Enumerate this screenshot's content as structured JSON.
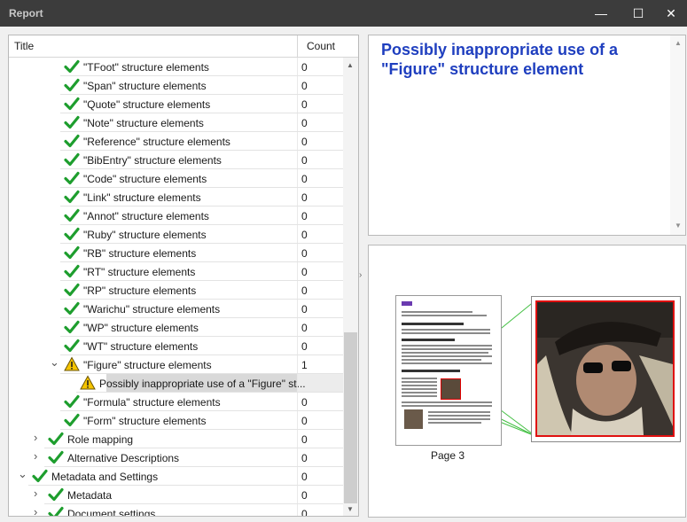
{
  "window": {
    "title": "Report",
    "min_icon": "minimize-icon",
    "max_icon": "maximize-icon",
    "close_icon": "close-icon"
  },
  "tree": {
    "columns": {
      "title": "Title",
      "count": "Count"
    },
    "rows": [
      {
        "label": "\"TFoot\" structure elements",
        "count": "0",
        "icon": "check-icon",
        "level": 4,
        "expander": ""
      },
      {
        "label": "\"Span\" structure elements",
        "count": "0",
        "icon": "check-icon",
        "level": 4,
        "expander": ""
      },
      {
        "label": "\"Quote\" structure elements",
        "count": "0",
        "icon": "check-icon",
        "level": 4,
        "expander": ""
      },
      {
        "label": "\"Note\" structure elements",
        "count": "0",
        "icon": "check-icon",
        "level": 4,
        "expander": ""
      },
      {
        "label": "\"Reference\" structure elements",
        "count": "0",
        "icon": "check-icon",
        "level": 4,
        "expander": ""
      },
      {
        "label": "\"BibEntry\" structure elements",
        "count": "0",
        "icon": "check-icon",
        "level": 4,
        "expander": ""
      },
      {
        "label": "\"Code\" structure elements",
        "count": "0",
        "icon": "check-icon",
        "level": 4,
        "expander": ""
      },
      {
        "label": "\"Link\" structure elements",
        "count": "0",
        "icon": "check-icon",
        "level": 4,
        "expander": ""
      },
      {
        "label": "\"Annot\" structure elements",
        "count": "0",
        "icon": "check-icon",
        "level": 4,
        "expander": ""
      },
      {
        "label": "\"Ruby\" structure elements",
        "count": "0",
        "icon": "check-icon",
        "level": 4,
        "expander": ""
      },
      {
        "label": "\"RB\" structure elements",
        "count": "0",
        "icon": "check-icon",
        "level": 4,
        "expander": ""
      },
      {
        "label": "\"RT\" structure elements",
        "count": "0",
        "icon": "check-icon",
        "level": 4,
        "expander": ""
      },
      {
        "label": "\"RP\" structure elements",
        "count": "0",
        "icon": "check-icon",
        "level": 4,
        "expander": ""
      },
      {
        "label": "\"Warichu\" structure elements",
        "count": "0",
        "icon": "check-icon",
        "level": 4,
        "expander": ""
      },
      {
        "label": "\"WP\" structure elements",
        "count": "0",
        "icon": "check-icon",
        "level": 4,
        "expander": ""
      },
      {
        "label": "\"WT\" structure elements",
        "count": "0",
        "icon": "check-icon",
        "level": 4,
        "expander": ""
      },
      {
        "label": "\"Figure\" structure elements",
        "count": "1",
        "icon": "warning-icon",
        "level": 4,
        "expander": "chevron-down-icon"
      },
      {
        "label": "Possibly inappropriate use of a \"Figure\" st...",
        "count": "",
        "icon": "warning-icon",
        "level": 5,
        "expander": "",
        "selected": true
      },
      {
        "label": "\"Formula\" structure elements",
        "count": "0",
        "icon": "check-icon",
        "level": 4,
        "expander": ""
      },
      {
        "label": "\"Form\" structure elements",
        "count": "0",
        "icon": "check-icon",
        "level": 4,
        "expander": ""
      },
      {
        "label": "Role mapping",
        "count": "0",
        "icon": "check-icon",
        "level": 3,
        "expander": "chevron-right-icon"
      },
      {
        "label": "Alternative Descriptions",
        "count": "0",
        "icon": "check-icon",
        "level": 3,
        "expander": "chevron-right-icon"
      },
      {
        "label": "Metadata and Settings",
        "count": "0",
        "icon": "check-icon",
        "level": 2,
        "expander": "chevron-down-icon"
      },
      {
        "label": "Metadata",
        "count": "0",
        "icon": "check-icon",
        "level": 3,
        "expander": "chevron-right-icon"
      },
      {
        "label": "Document settings",
        "count": "0",
        "icon": "check-icon",
        "level": 3,
        "expander": "chevron-right-icon"
      }
    ]
  },
  "description": {
    "heading": "Possibly inappropriate use of a \"Figure\" structure element"
  },
  "preview": {
    "page_caption": "Page 3"
  },
  "colors": {
    "check": "#1e9e2e",
    "warning": "#f5c400",
    "heading": "#1f3fbf",
    "highlight": "#e01010"
  }
}
